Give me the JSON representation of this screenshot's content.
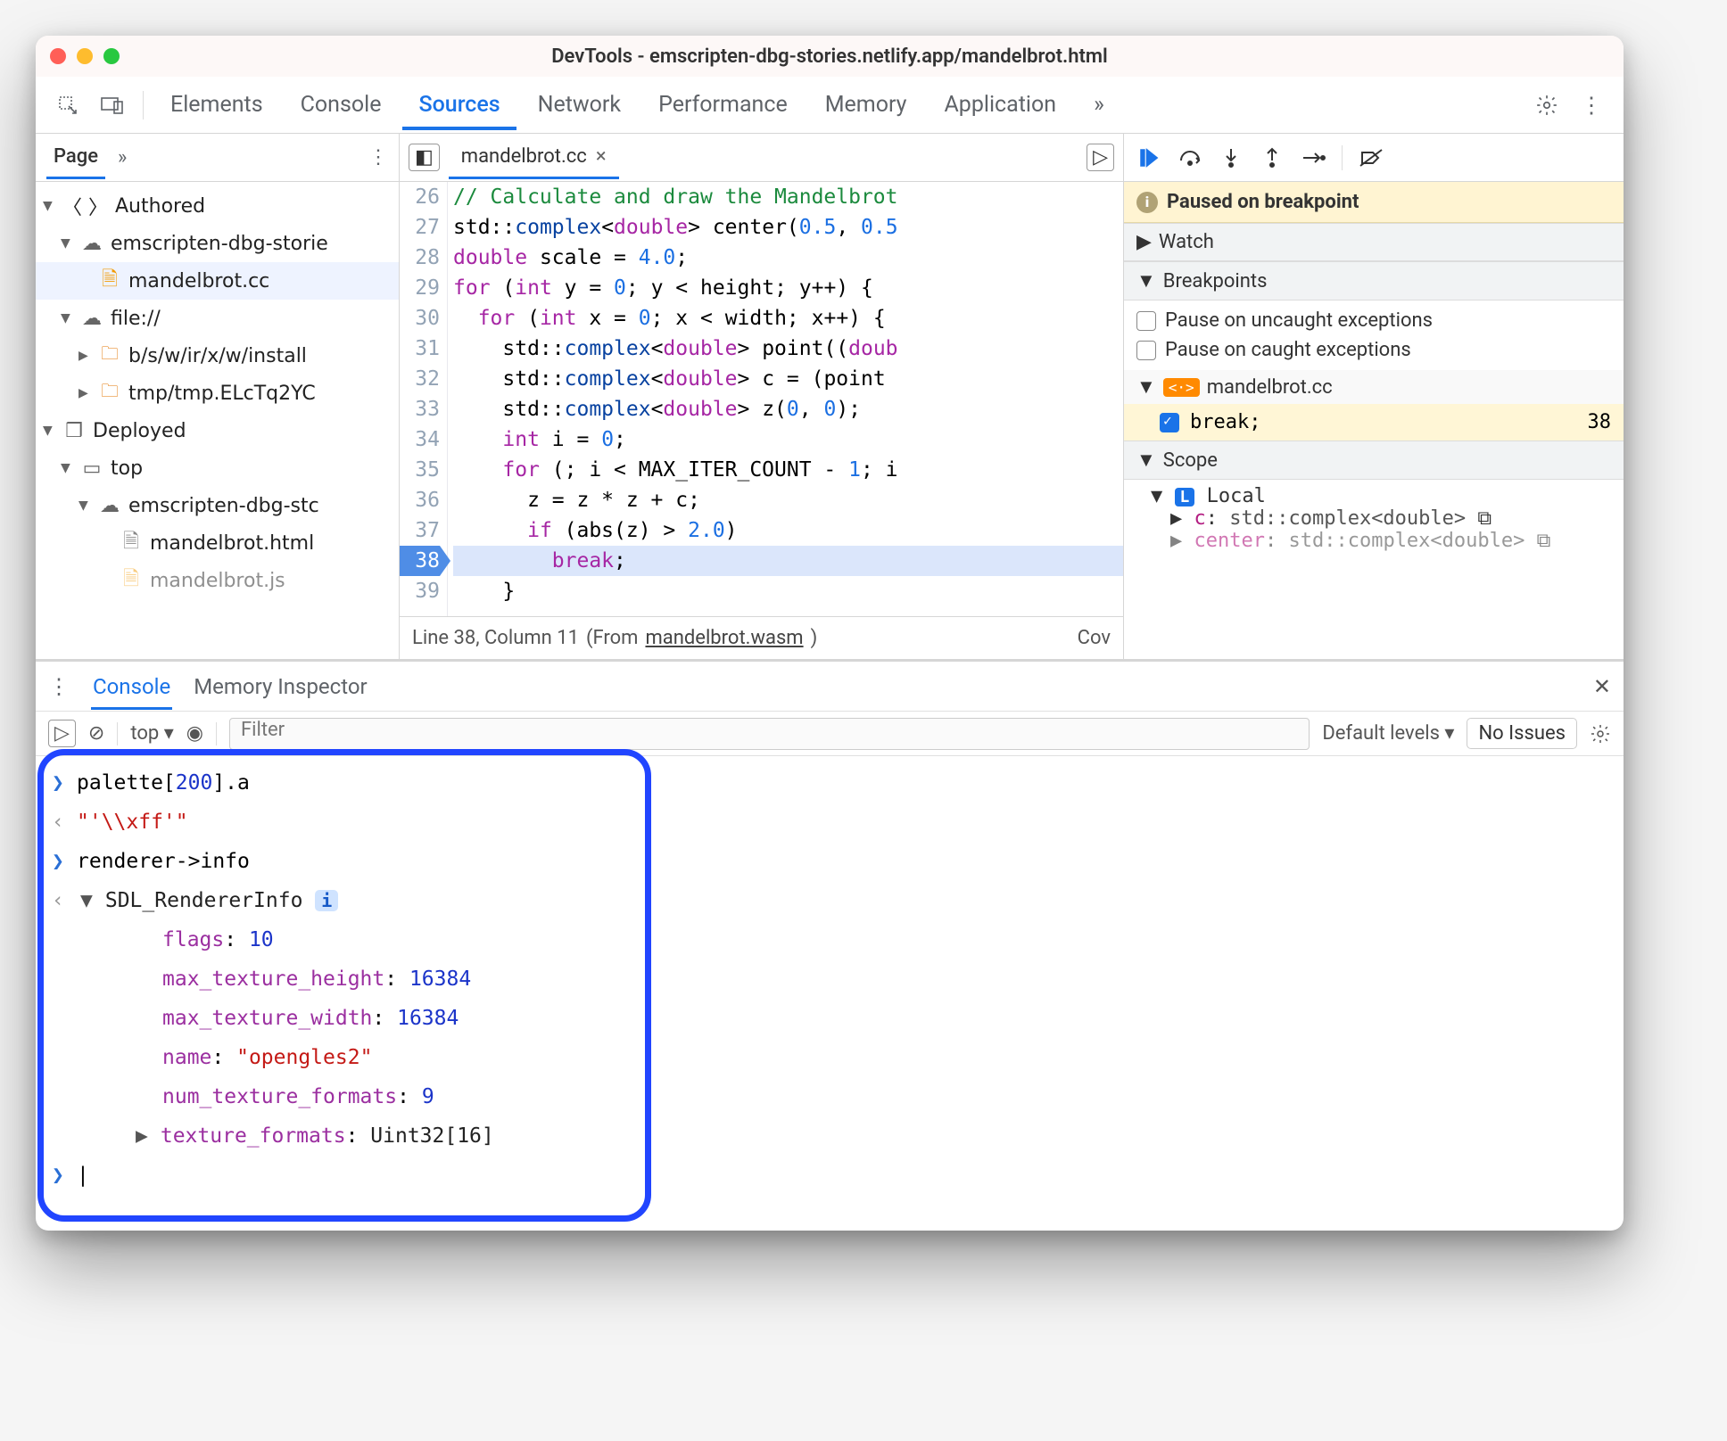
{
  "window": {
    "title": "DevTools - emscripten-dbg-stories.netlify.app/mandelbrot.html"
  },
  "tabs": {
    "items": [
      "Elements",
      "Console",
      "Sources",
      "Network",
      "Performance",
      "Memory",
      "Application"
    ],
    "active_index": 2,
    "overflow": "»"
  },
  "sidebar": {
    "tabs": {
      "active": "Page",
      "overflow": "»"
    },
    "tree": {
      "authored_label": "Authored",
      "domain1": "emscripten-dbg-storie",
      "file_selected": "mandelbrot.cc",
      "file_scheme": "file://",
      "folder1": "b/s/w/ir/x/w/install",
      "folder2": "tmp/tmp.ELcTq2YC",
      "deployed_label": "Deployed",
      "top_label": "top",
      "domain2": "emscripten-dbg-stc",
      "file_html": "mandelbrot.html",
      "file_js": "mandelbrot.js"
    }
  },
  "editor": {
    "tab_filename": "mandelbrot.cc",
    "lines": {
      "start": 26,
      "content": [
        {
          "n": 26,
          "html": "<span class='c-cmt'>// Calculate and draw the Mandelbrot</span>"
        },
        {
          "n": 27,
          "html": "std::<span class='c-ns'>complex</span>&lt;<span class='c-kw'>double</span>&gt; center(<span class='c-num'>0.5</span>, <span class='c-num'>0.5</span>"
        },
        {
          "n": 28,
          "html": "<span class='c-kw'>double</span> scale = <span class='c-num'>4.0</span>;"
        },
        {
          "n": 29,
          "html": "<span class='c-kw'>for</span> (<span class='c-kw'>int</span> y = <span class='c-num'>0</span>; y &lt; height; y++) {"
        },
        {
          "n": 30,
          "html": "  <span class='c-kw'>for</span> (<span class='c-kw'>int</span> x = <span class='c-num'>0</span>; x &lt; width; x++) {"
        },
        {
          "n": 31,
          "html": "    std::<span class='c-ns'>complex</span>&lt;<span class='c-kw'>double</span>&gt; point((<span class='c-kw'>doub</span>"
        },
        {
          "n": 32,
          "html": "    std::<span class='c-ns'>complex</span>&lt;<span class='c-kw'>double</span>&gt; c = (point "
        },
        {
          "n": 33,
          "html": "    std::<span class='c-ns'>complex</span>&lt;<span class='c-kw'>double</span>&gt; z(<span class='c-num'>0</span>, <span class='c-num'>0</span>);"
        },
        {
          "n": 34,
          "html": "    <span class='c-kw'>int</span> i = <span class='c-num'>0</span>;"
        },
        {
          "n": 35,
          "html": "    <span class='c-kw'>for</span> (; i &lt; MAX_ITER_COUNT - <span class='c-num'>1</span>; i"
        },
        {
          "n": 36,
          "html": "      z = z * z + c;"
        },
        {
          "n": 37,
          "html": "      <span class='c-kw'>if</span> (abs(z) &gt; <span class='c-num'>2.0</span>)"
        },
        {
          "n": 38,
          "html": "        <span class='c-kw'>break</span>;",
          "break": true,
          "current": true
        },
        {
          "n": 39,
          "html": "    }"
        }
      ]
    },
    "status": {
      "pos": "Line 38, Column 11",
      "from_label": "(From ",
      "from_link": "mandelbrot.wasm",
      "close": ")",
      "cov": "Cov"
    }
  },
  "debug": {
    "paused_label": "Paused on breakpoint",
    "sections": {
      "watch": "Watch",
      "breakpoints": "Breakpoints",
      "scope": "Scope"
    },
    "bp_checks": {
      "uncaught": "Pause on uncaught exceptions",
      "caught": "Pause on caught exceptions"
    },
    "bp_file": "mandelbrot.cc",
    "bp_row": {
      "label": "break;",
      "line": "38"
    },
    "scope": {
      "local_label": "Local",
      "row1_k": "c",
      "row1_t": "std::complex<double>",
      "row2_k": "center",
      "row2_t": "std::complex<double>"
    }
  },
  "drawer": {
    "tabs": {
      "active": "Console",
      "other": "Memory Inspector"
    },
    "toolbar": {
      "context": "top",
      "filter_placeholder": "Filter",
      "levels": "Default levels",
      "issues": "No Issues"
    }
  },
  "console": {
    "rows": [
      {
        "dir": "in",
        "html": "palette[<span class='con-blue'>200</span>].a"
      },
      {
        "dir": "out",
        "html": "<span class='con-red'>\"'\\\\xff'\"</span>"
      },
      {
        "dir": "in",
        "html": "renderer-&gt;info"
      },
      {
        "dir": "out",
        "html": "<span class='tri'>▼</span> <span class='con-black'>SDL_RendererInfo</span> <span class='info-badge'>i</span>",
        "obj": true
      },
      {
        "prop": true,
        "html": "<span class='con-key'>flags</span>: <span class='con-val-num'>10</span>"
      },
      {
        "prop": true,
        "html": "<span class='con-key'>max_texture_height</span>: <span class='con-val-num'>16384</span>"
      },
      {
        "prop": true,
        "html": "<span class='con-key'>max_texture_width</span>: <span class='con-val-num'>16384</span>"
      },
      {
        "prop": true,
        "html": "<span class='con-key'>name</span>: <span class='con-val-str'>\"opengles2\"</span>"
      },
      {
        "prop": true,
        "html": "<span class='con-key'>num_texture_formats</span>: <span class='con-val-num'>9</span>"
      },
      {
        "prop": true,
        "html": "<span class='tri'>▶</span> <span class='con-key'>texture_formats</span>: <span class='con-black'>Uint32[16]</span>",
        "nested": true
      }
    ],
    "prompt": ""
  }
}
